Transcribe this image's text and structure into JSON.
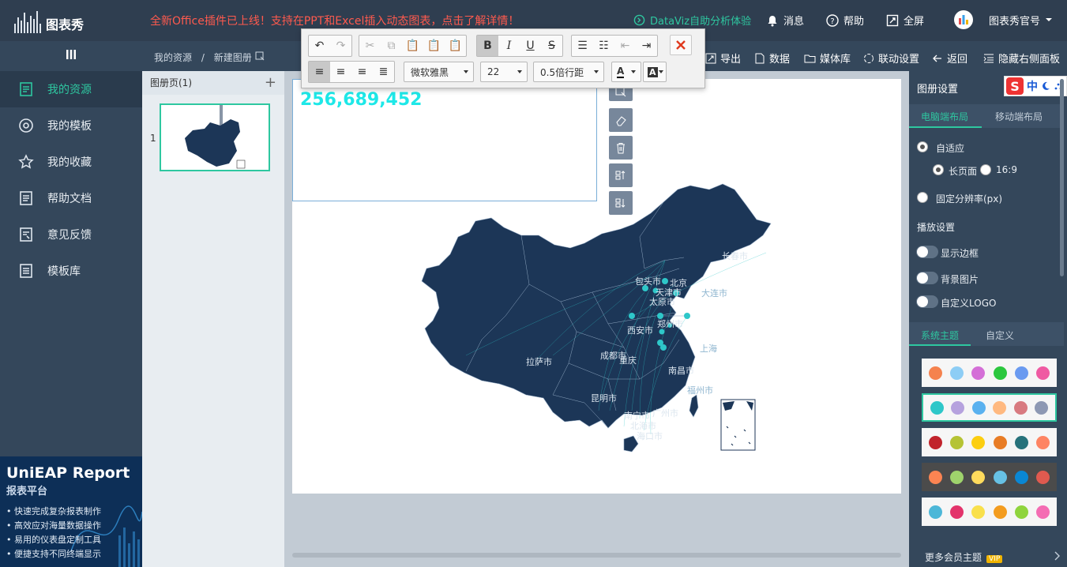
{
  "header": {
    "brand": "图表秀",
    "promo": "全新Office插件已上线！支持在PPT和Excel插入动态图表，点击了解详情！",
    "dataviz": "DataViz自助分析体验",
    "messages": "消息",
    "help": "帮助",
    "fullscreen": "全屏",
    "account": "图表秀官号"
  },
  "breadcrumb": {
    "root": "我的资源",
    "sep": "/",
    "current": "新建图册"
  },
  "actions": [
    "导出",
    "数据",
    "媒体库",
    "联动设置",
    "返回",
    "隐藏右侧面板"
  ],
  "sidebar": {
    "items": [
      {
        "label": "我的资源",
        "icon": "resource-icon",
        "active": true
      },
      {
        "label": "我的模板",
        "icon": "template-icon",
        "active": false
      },
      {
        "label": "我的收藏",
        "icon": "star-icon",
        "active": false
      },
      {
        "label": "帮助文档",
        "icon": "doc-icon",
        "active": false
      },
      {
        "label": "意见反馈",
        "icon": "feedback-icon",
        "active": false
      },
      {
        "label": "模板库",
        "icon": "library-icon",
        "active": false
      }
    ]
  },
  "ad": {
    "title": "UniEAP Report",
    "subtitle": "报表平台",
    "lines": [
      "• 快速完成复杂报表制作",
      "• 高效应对海量数据操作",
      "• 易用的仪表盘定制工具",
      "• 便捷支持不同终端显示"
    ]
  },
  "pages": {
    "header": "图册页(1)",
    "add": "+",
    "page_number": "1"
  },
  "editor": {
    "value": "256,689,452",
    "font": "微软雅黑",
    "size": "22",
    "line_height": "0.5倍行距"
  },
  "map": {
    "cities": [
      "长春市",
      "包头市",
      "北京",
      "大连市",
      "天津市",
      "太原市",
      "西安市",
      "郑州市",
      "上海",
      "成都市",
      "重庆",
      "拉萨市",
      "南昌市",
      "福州市",
      "昆明市",
      "南宁市",
      "广州市",
      "北海市",
      "海口市"
    ]
  },
  "right_panel": {
    "title": "图册设置",
    "layout_tabs": [
      "电脑端布局",
      "移动端布局"
    ],
    "adaptive": "自适应",
    "long_page": "长页面",
    "ratio": "16:9",
    "fixed_res": "固定分辨率(px)",
    "playback": "播放设置",
    "show_border": "显示边框",
    "bg_image": "背景图片",
    "custom_logo": "自定义LOGO",
    "theme_tabs": [
      "系统主题",
      "自定义"
    ],
    "more_themes": "更多会员主题",
    "vip": "VIP",
    "themes": [
      [
        "#f5824e",
        "#8dcdf5",
        "#d46fd7",
        "#2bc73e",
        "#6a9af0",
        "#ef5aa2"
      ],
      [
        "#2ec7c9",
        "#b6a2de",
        "#5ab1ef",
        "#ffb980",
        "#d87a80",
        "#8d98b3"
      ],
      [
        "#c1232b",
        "#b5c334",
        "#fcce10",
        "#e87c25",
        "#27727b",
        "#fe8463"
      ],
      [
        "#fc8452",
        "#9fd36c",
        "#ffdb5c",
        "#67c1e4",
        "#0a87d4",
        "#e05a4f"
      ],
      [
        "#4cb7d8",
        "#e3336b",
        "#f9e04c",
        "#f39c1f",
        "#8fd43d",
        "#f46cb3"
      ]
    ]
  },
  "ime": {
    "label1": "中"
  }
}
